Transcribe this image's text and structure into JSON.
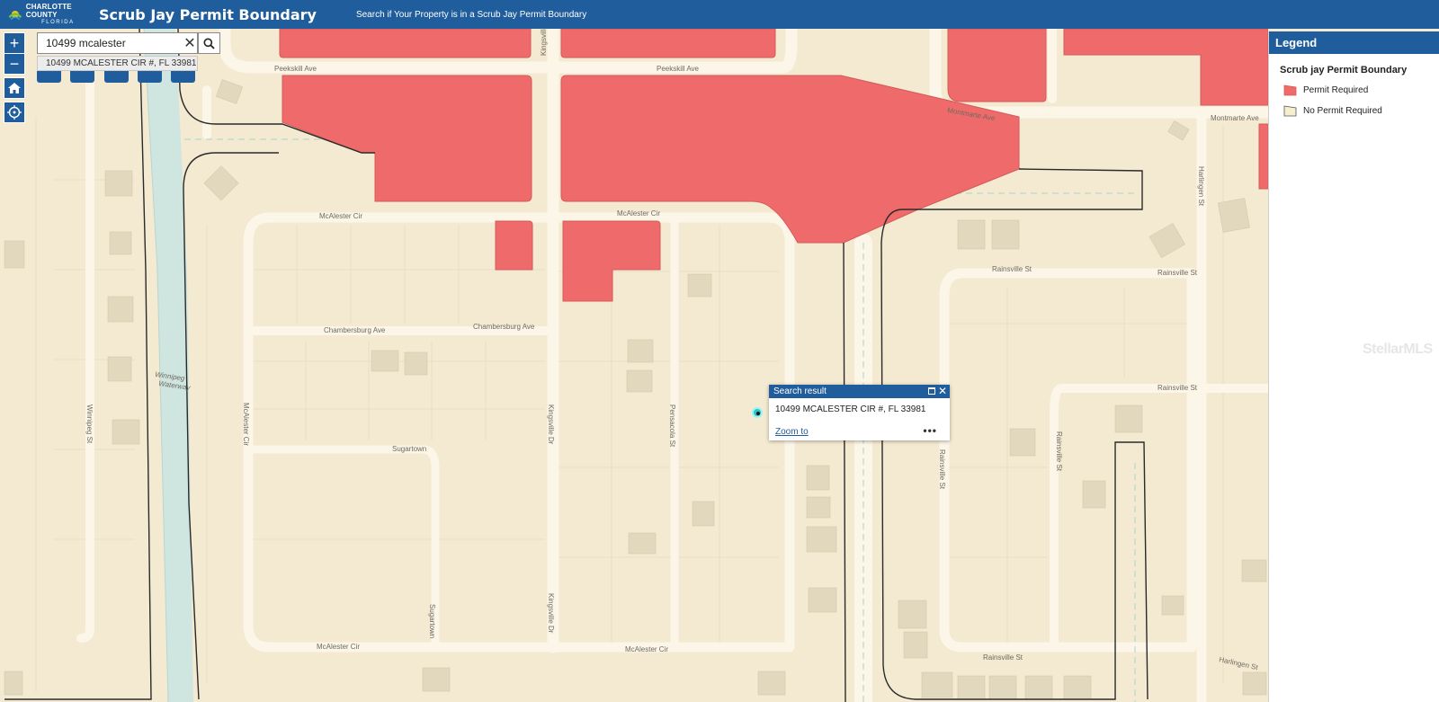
{
  "header": {
    "logo_line1": "CHARLOTTE COUNTY",
    "logo_line2": "FLORIDA",
    "title": "Scrub Jay Permit Boundary",
    "subtitle": "Search if Your Property is in a Scrub Jay Permit Boundary"
  },
  "controls": {
    "zoom_in": "+",
    "zoom_out": "−",
    "home_icon": "home-icon",
    "locate_icon": "locate-icon"
  },
  "search": {
    "value": "10499 mcalester",
    "clear_label": "✕",
    "suggestion": "10499 MCALESTER CIR #, FL 33981"
  },
  "popup": {
    "title": "Search result",
    "address": "10499 MCALESTER CIR #, FL 33981",
    "zoom_link": "Zoom to",
    "more_label": "•••",
    "close_label": "✕"
  },
  "legend": {
    "header": "Legend",
    "layer_title": "Scrub jay Permit Boundary",
    "items": [
      {
        "label": "Permit Required",
        "color": "#ef6b6b"
      },
      {
        "label": "No Permit Required",
        "color": "#f6efcf"
      }
    ]
  },
  "map": {
    "colors": {
      "land": "#f4ead2",
      "road": "#fbf6e8",
      "parcel_line": "#e6dcc3",
      "building": "#e2d8bd",
      "water": "#cfe5e0",
      "permit_fill": "#ef6b6b",
      "boundary": "#2a2a2a"
    },
    "road_labels": {
      "peekskill_1": "Peekskill Ave",
      "peekskill_2": "Peekskill Ave",
      "montmarte_1": "Montmarte Ave",
      "montmarte_2": "Montmarte Ave",
      "mcalester_1": "McAlester Cir",
      "mcalester_2": "McAlester Cir",
      "mcalester_3": "McAlester Cir",
      "mcalester_4": "McAlester Cir",
      "mcalester_v": "McAlester Cir",
      "chambersburg_1": "Chambersburg Ave",
      "chambersburg_2": "Chambersburg Ave",
      "rainsville_1": "Rainsville St",
      "rainsville_2": "Rainsville St",
      "rainsville_3": "Rainsville St",
      "rainsville_4": "Rainsville St",
      "rainsville_v": "Rainsville St",
      "kingsville_1": "Kingsville Dr",
      "kingsville_2": "Kingsville Dr",
      "kingsville_3": "Kingsville Dr",
      "pensacola": "Pensacola St",
      "sugartown_1": "Sugartown",
      "sugartown_2": "Sugartown",
      "winnipeg_st": "Winnipeg St",
      "waterway_1": "Winnipeg",
      "waterway_2": "Waterway",
      "harlingen_1": "Harlingen St",
      "harlingen_2": "Harlingen St"
    }
  },
  "watermark": "StellarMLS"
}
